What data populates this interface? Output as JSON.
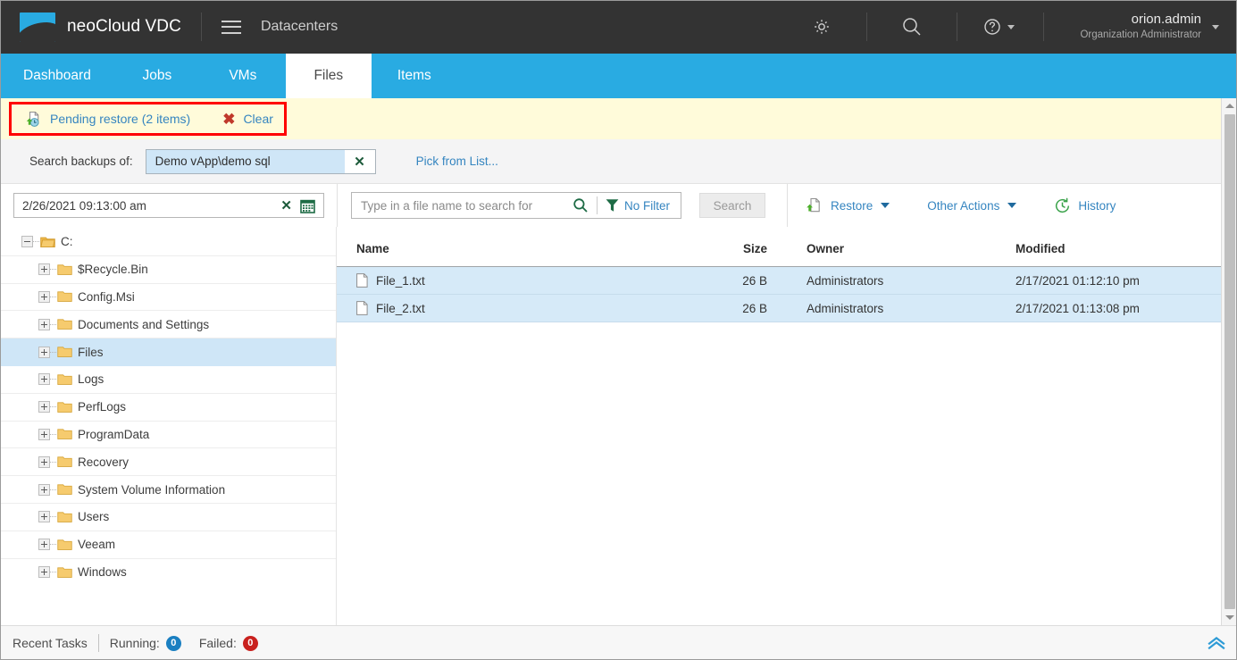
{
  "header": {
    "brand": "neoCloud VDC",
    "logo_icon": "cloud-swoosh-logo",
    "menu_icon": "hamburger-menu-icon",
    "context_title": "Datacenters",
    "gear_icon": "gear-icon",
    "search_icon": "search-icon",
    "help_icon": "help-circle-icon",
    "user_name": "orion.admin",
    "user_role": "Organization Administrator",
    "user_caret_icon": "chevron-down-icon"
  },
  "tabs": [
    {
      "label": "Dashboard",
      "active": false
    },
    {
      "label": "Jobs",
      "active": false
    },
    {
      "label": "VMs",
      "active": false
    },
    {
      "label": "Files",
      "active": true
    },
    {
      "label": "Items",
      "active": false
    }
  ],
  "notice": {
    "icon": "pending-restore-icon",
    "text": "Pending restore (2 items)",
    "clear_label": "Clear",
    "clear_icon": "red-x-icon",
    "highlight_color": "#ff0000",
    "bg_color": "#fffbda"
  },
  "search_backups": {
    "label": "Search backups of:",
    "value": "Demo vApp\\demo sql",
    "clear_icon": "clear-x-icon",
    "pick_link": "Pick from List..."
  },
  "toolbar": {
    "date_value": "2/26/2021 09:13:00 am",
    "date_clear_icon": "clear-x-icon",
    "calendar_icon": "calendar-icon",
    "file_search_placeholder": "Type in a file name to search for",
    "file_search_value": "",
    "search_icon": "search-icon",
    "filter_icon": "funnel-filter-icon",
    "filter_label": "No Filter",
    "search_button": "Search",
    "restore_label": "Restore",
    "restore_icon": "restore-file-icon",
    "other_actions_label": "Other Actions",
    "history_label": "History",
    "history_icon": "history-clock-icon",
    "caret_icon": "chevron-down-icon"
  },
  "tree": {
    "root": {
      "label": "C:",
      "expander": "minus",
      "icon": "folder-open-icon"
    },
    "items": [
      {
        "label": "$Recycle.Bin",
        "selected": false
      },
      {
        "label": "Config.Msi",
        "selected": false
      },
      {
        "label": "Documents and Settings",
        "selected": false
      },
      {
        "label": "Files",
        "selected": true
      },
      {
        "label": "Logs",
        "selected": false
      },
      {
        "label": "PerfLogs",
        "selected": false
      },
      {
        "label": "ProgramData",
        "selected": false
      },
      {
        "label": "Recovery",
        "selected": false
      },
      {
        "label": "System Volume Information",
        "selected": false
      },
      {
        "label": "Users",
        "selected": false
      },
      {
        "label": "Veeam",
        "selected": false
      },
      {
        "label": "Windows",
        "selected": false
      }
    ]
  },
  "file_table": {
    "columns": [
      "Name",
      "Size",
      "Owner",
      "Modified"
    ],
    "rows": [
      {
        "name": "File_1.txt",
        "size": "26 B",
        "owner": "Administrators",
        "modified": "2/17/2021 01:12:10 pm",
        "icon": "text-file-icon",
        "selected": true
      },
      {
        "name": "File_2.txt",
        "size": "26 B",
        "owner": "Administrators",
        "modified": "2/17/2021 01:13:08 pm",
        "icon": "text-file-icon",
        "selected": true
      }
    ],
    "row_highlight_color": "#d6eaf8"
  },
  "footer": {
    "recent_tasks": "Recent Tasks",
    "running_label": "Running:",
    "running_count": "0",
    "failed_label": "Failed:",
    "failed_count": "0",
    "expand_icon": "double-chevron-up-icon"
  },
  "colors": {
    "accent_blue": "#29abe2",
    "header_dark": "#333333",
    "link_blue": "#3585c0",
    "notice_yellow": "#fffbda",
    "select_blue": "#d6eaf8",
    "alert_red": "#ff0000"
  }
}
